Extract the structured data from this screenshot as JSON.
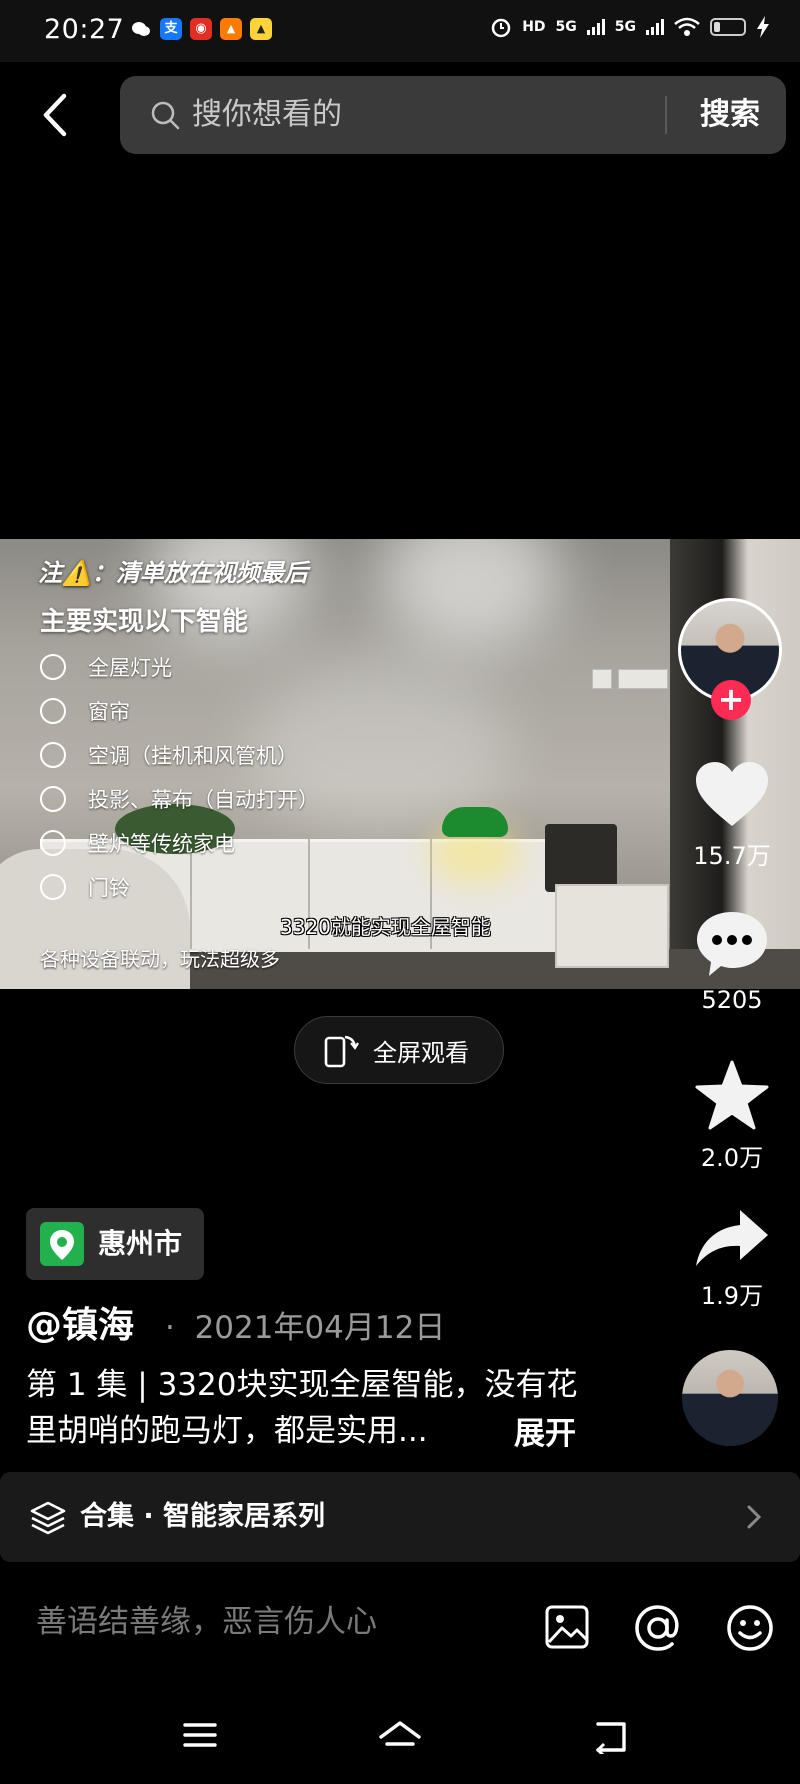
{
  "status_bar": {
    "time": "20:27",
    "app_icons": [
      {
        "name": "wechat-icon",
        "glyph": "●",
        "color": "#ffffff",
        "bg": "transparent"
      },
      {
        "name": "alipay-icon",
        "glyph": "支",
        "color": "#ffffff",
        "bg": "#1677ff"
      },
      {
        "name": "pinduoduo-icon",
        "glyph": "◉",
        "color": "#ffffff",
        "bg": "#e02e24"
      },
      {
        "name": "taobao-icon",
        "glyph": "▲",
        "color": "#ffffff",
        "bg": "#ff7a00"
      },
      {
        "name": "notice-icon",
        "glyph": "▲",
        "color": "#222222",
        "bg": "#ffd43b"
      }
    ],
    "hd_label": "HD",
    "signal_1": "5G",
    "signal_2": "5G"
  },
  "search": {
    "placeholder": "搜你想看的",
    "button_label": "搜索"
  },
  "video": {
    "note": "注⚠️：清单放在视频最后",
    "title": "主要实现以下智能",
    "features": [
      "全屋灯光",
      "窗帘",
      "空调（挂机和风管机）",
      "投影、幕布（自动打开）",
      "壁炉等传统家电",
      "门铃"
    ],
    "subtitle": "各种设备联动，玩法超级多",
    "caption": "3320就能实现全屋智能"
  },
  "fullscreen_label": "全屏观看",
  "actions": {
    "likes": "15.7万",
    "comments": "5205",
    "favorites": "2.0万",
    "shares": "1.9万"
  },
  "post": {
    "location": "惠州市",
    "author": "@镇海",
    "date": "2021年04月12日",
    "description": "第 1 集 | 3320块实现全屋智能，没有花里胡哨的跑马灯，都是实用...",
    "expand_label": "展开"
  },
  "collection": {
    "label": "合集 · 智能家居系列"
  },
  "comment": {
    "placeholder": "善语结善缘，恶言伤人心"
  },
  "colors": {
    "accent_red": "#fe2c55",
    "location_green": "#22b14c",
    "background": "#000000"
  }
}
